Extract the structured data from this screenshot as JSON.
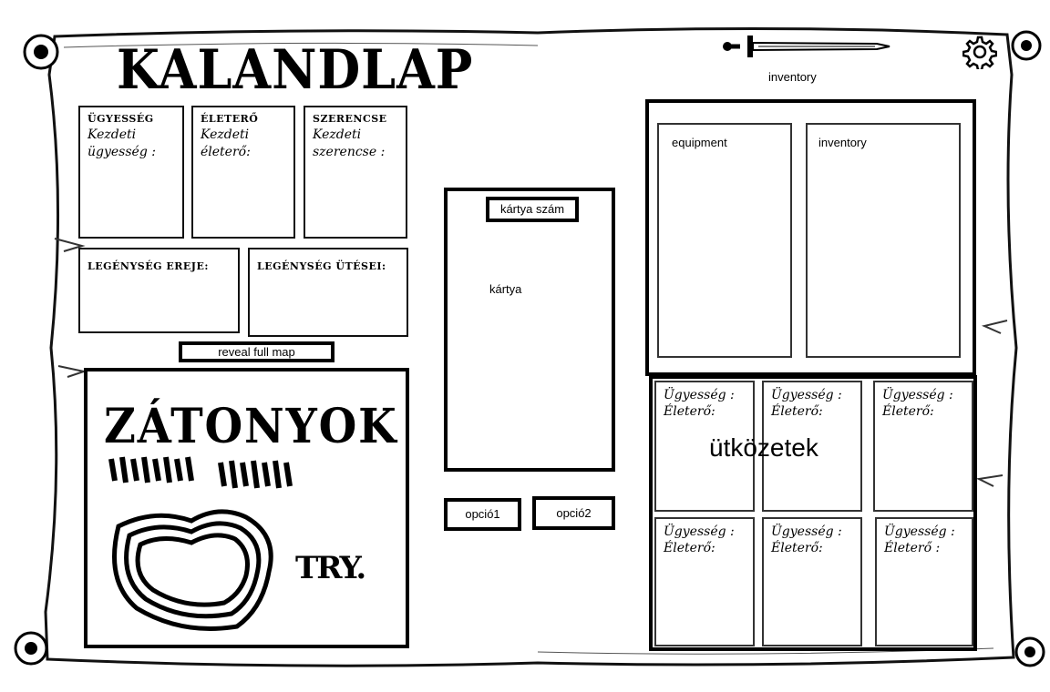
{
  "header": {
    "title": "KALANDLAP",
    "settings_icon": "gear-icon",
    "sword_icon": "sword-icon",
    "inventory_label": "inventory"
  },
  "stats": {
    "ugyesseg": {
      "head": "ÜGYESSÉG",
      "line1": "Kezdeti",
      "line2": "ügyesség :"
    },
    "eletero": {
      "head": "ÉLETERŐ",
      "line1": "Kezdeti",
      "line2": "életerő:"
    },
    "szerencse": {
      "head": "SZERENCSE",
      "line1": "Kezdeti",
      "line2": "szerencse :"
    },
    "legenyseg_ereje": {
      "head": "LEGÉNYSÉG EREJE:"
    },
    "legenyseg_utesei": {
      "head": "LEGÉNYSÉG ÜTÉSEI:"
    }
  },
  "map": {
    "reveal_button": "reveal full map",
    "title": "ZÁTONYOK",
    "label_small": "TRY."
  },
  "card": {
    "number_label": "kártya szám",
    "card_label": "kártya",
    "option1": "opció1",
    "option2": "opció2"
  },
  "inventory_panel": {
    "equipment_label": "equipment",
    "inventory_label": "inventory"
  },
  "encounters": {
    "title": "ütközetek",
    "cells": [
      {
        "l1": "Ügyesség :",
        "l2": "Életerő:"
      },
      {
        "l1": "Ügyesség :",
        "l2": "Életerő:"
      },
      {
        "l1": "Ügyesség :",
        "l2": "Életerő:"
      },
      {
        "l1": "Ügyesség :",
        "l2": "Életerő:"
      },
      {
        "l1": "Ügyesség :",
        "l2": "Életerő:"
      },
      {
        "l1": "Ügyesség :",
        "l2": "Életerő :"
      }
    ]
  }
}
